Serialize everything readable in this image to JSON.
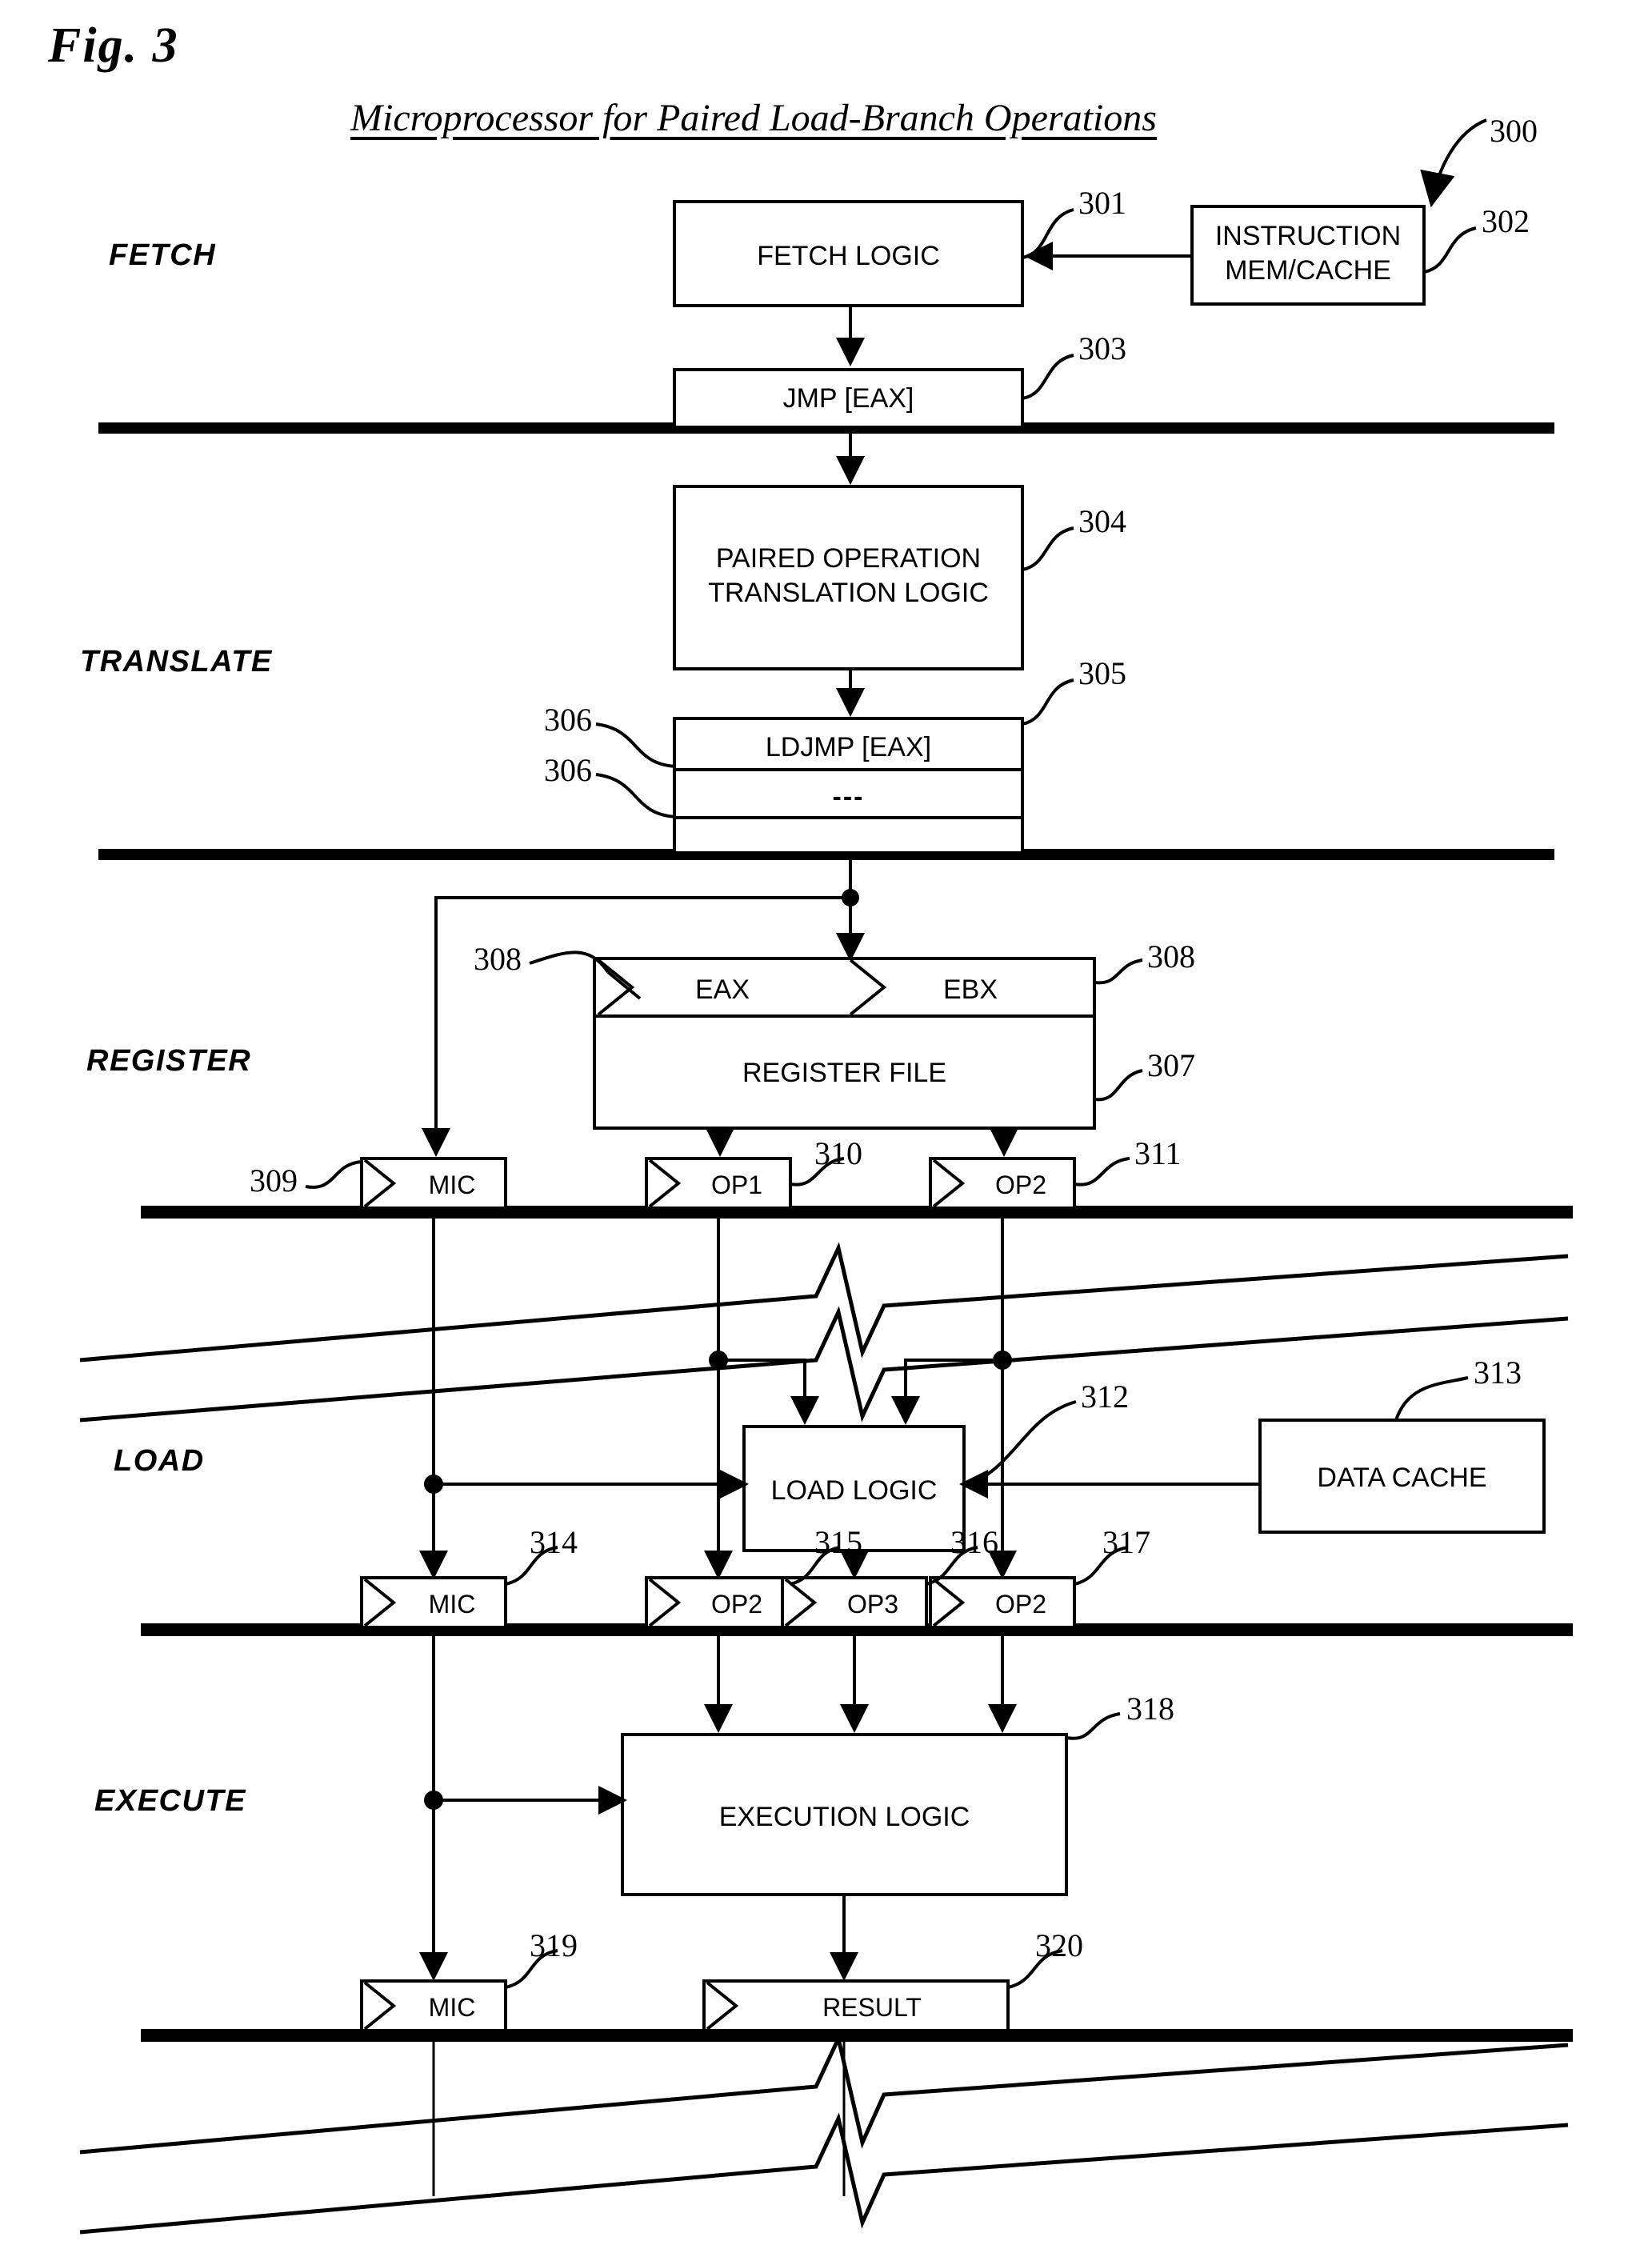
{
  "figure": {
    "number": "Fig. 3",
    "title": "Microprocessor for Paired Load-Branch Operations",
    "system_ref": "300"
  },
  "stages": [
    {
      "label": "FETCH"
    },
    {
      "label": "TRANSLATE"
    },
    {
      "label": "REGISTER"
    },
    {
      "label": "LOAD"
    },
    {
      "label": "EXECUTE"
    }
  ],
  "blocks": {
    "fetch_logic": {
      "label": "FETCH LOGIC",
      "ref": "301"
    },
    "instruction_cache": {
      "label": "INSTRUCTION\nMEM/CACHE",
      "ref": "302"
    },
    "jmp_eax": {
      "label": "JMP [EAX]",
      "ref": "303"
    },
    "paired_translate": {
      "label": "PAIRED OPERATION\nTRANSLATION LOGIC",
      "ref": "304"
    },
    "ldjmp_eax": {
      "label": "LDJMP [EAX]",
      "ref": "305"
    },
    "uop_slot_1_ref": {
      "ref": "306"
    },
    "uop_slot_2": {
      "label": "---",
      "ref": "306"
    },
    "register_file": {
      "label": "REGISTER FILE",
      "ref": "307"
    },
    "reg_eax": {
      "label": "EAX",
      "ref": "308"
    },
    "reg_ebx": {
      "label": "EBX",
      "ref": "308"
    },
    "load_logic": {
      "label": "LOAD LOGIC",
      "ref": "312"
    },
    "data_cache": {
      "label": "DATA CACHE",
      "ref": "313"
    },
    "execution_logic": {
      "label": "EXECUTION LOGIC",
      "ref": "318"
    }
  },
  "latches": {
    "register_stage": [
      {
        "label": "MIC",
        "ref": "309"
      },
      {
        "label": "OP1",
        "ref": "310"
      },
      {
        "label": "OP2",
        "ref": "311"
      }
    ],
    "load_stage": [
      {
        "label": "MIC",
        "ref": "314"
      },
      {
        "label": "OP2",
        "ref": "315"
      },
      {
        "label": "OP3",
        "ref": "316"
      },
      {
        "label": "OP2",
        "ref": "317"
      }
    ],
    "execute_stage": [
      {
        "label": "MIC",
        "ref": "319"
      },
      {
        "label": "RESULT",
        "ref": "320"
      }
    ]
  },
  "colors": {
    "ink": "#000000",
    "paper": "#ffffff"
  }
}
